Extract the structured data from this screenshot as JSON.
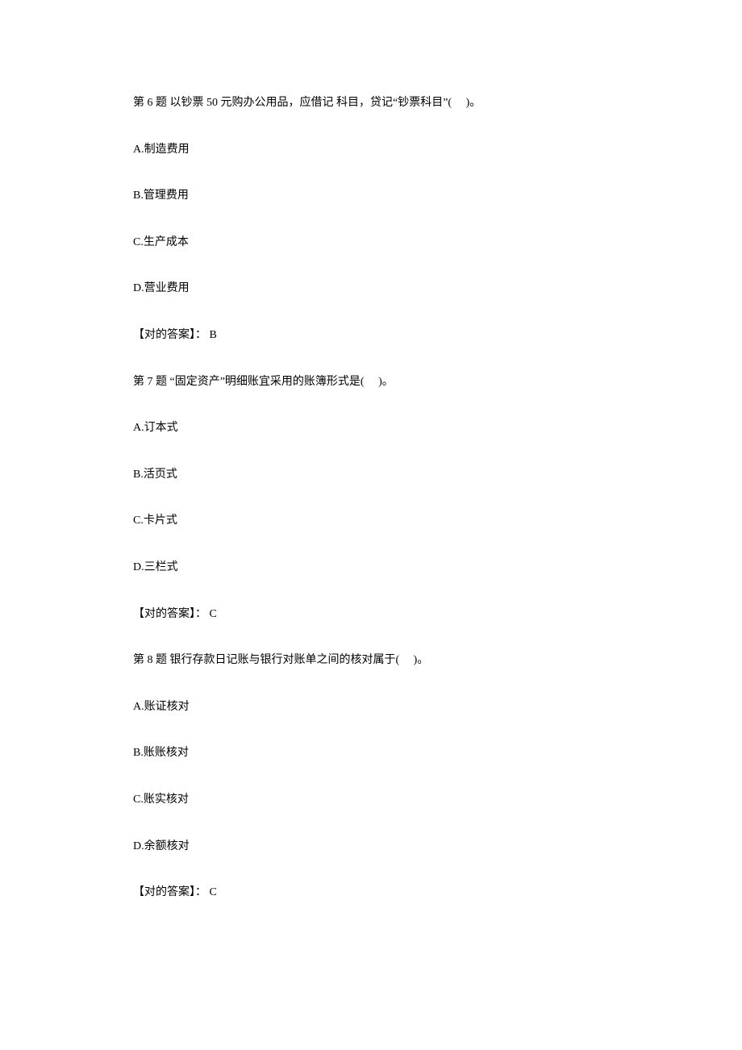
{
  "questions": [
    {
      "q_text": "第 6 题  以钞票 50 元购办公用品，应借记 科目，贷记“钞票科目”(　 )。",
      "opt_a": "A.制造费用",
      "opt_b": "B.管理费用",
      "opt_c": "C.生产成本",
      "opt_d": "D.营业费用",
      "answer": "【对的答案】： B"
    },
    {
      "q_text": "第 7 题  “固定资产”明细账宜采用的账簿形式是(　 )。",
      "opt_a": "A.订本式",
      "opt_b": "B.活页式",
      "opt_c": "C.卡片式",
      "opt_d": "D.三栏式",
      "answer": "【对的答案】： C"
    },
    {
      "q_text": "第 8 题  银行存款日记账与银行对账单之间的核对属于(　 )。",
      "opt_a": "A.账证核对",
      "opt_b": "B.账账核对",
      "opt_c": "C.账实核对",
      "opt_d": "D.余额核对",
      "answer": "【对的答案】： C"
    }
  ]
}
